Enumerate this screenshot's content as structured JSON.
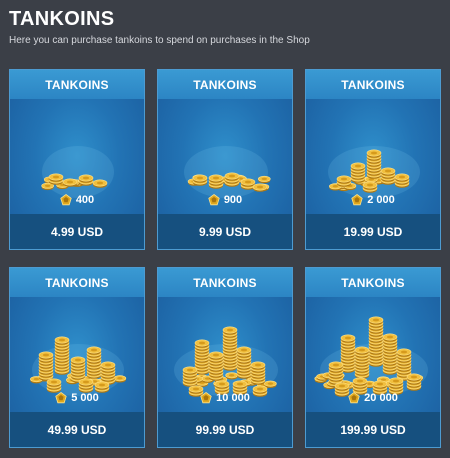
{
  "page": {
    "title": "TANKOINS",
    "subtitle": "Here you can purchase tankoins to spend on purchases in the Shop"
  },
  "colors": {
    "background": "#3b3f47",
    "card_top": "#2c85c4",
    "card_body": "#2273b4",
    "price_bar": "#16507f",
    "coin_gold": "#e8b32a"
  },
  "packages": [
    {
      "label": "TANKOINS",
      "amount": "400",
      "price": "4.99 USD",
      "icon": "coin-pile-icon"
    },
    {
      "label": "TANKOINS",
      "amount": "900",
      "price": "9.99 USD",
      "icon": "coin-pile-icon"
    },
    {
      "label": "TANKOINS",
      "amount": "2 000",
      "price": "19.99 USD",
      "icon": "coin-pile-icon"
    },
    {
      "label": "TANKOINS",
      "amount": "5 000",
      "price": "49.99 USD",
      "icon": "coin-pile-icon"
    },
    {
      "label": "TANKOINS",
      "amount": "10 000",
      "price": "99.99 USD",
      "icon": "coin-pile-icon"
    },
    {
      "label": "TANKOINS",
      "amount": "20 000",
      "price": "199.99 USD",
      "icon": "coin-pile-icon"
    }
  ]
}
